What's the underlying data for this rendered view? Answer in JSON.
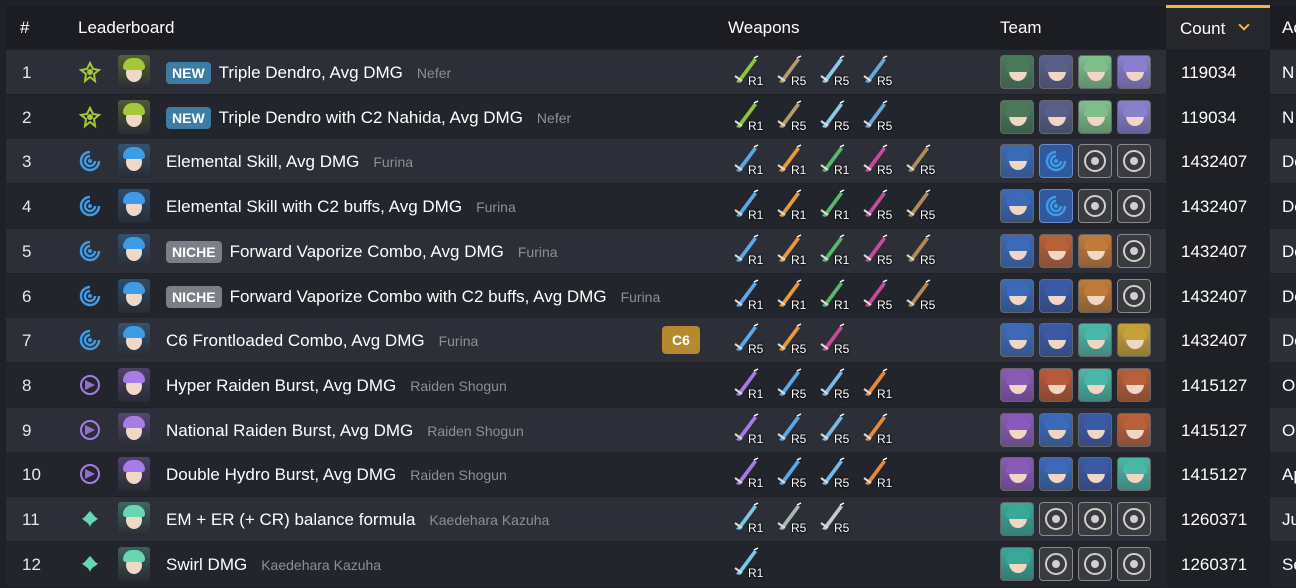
{
  "header": {
    "rank": "#",
    "leaderboard": "Leaderboard",
    "weapons": "Weapons",
    "team": "Team",
    "count": "Count",
    "extra": "Ac"
  },
  "colors": {
    "accent": "#f5b443",
    "dendro": "#a5c83b",
    "hydro": "#3e9be6",
    "electro": "#a77be8",
    "anemo": "#66d6b3",
    "new_badge": "#3d7da3",
    "niche_badge": "#7d7f86",
    "constellation_badge": "#b58a2e"
  },
  "rows": [
    {
      "rank": "1",
      "element": "dendro",
      "badge": "NEW",
      "badge_type": "new",
      "name": "Triple Dendro, Avg DMG",
      "owner": "Nefer",
      "constellation": "",
      "weapons": [
        {
          "icon": "catalyst-icon",
          "color": "#8fc43a",
          "ref": "R1"
        },
        {
          "icon": "catalyst-icon",
          "color": "#b59a6a",
          "ref": "R5"
        },
        {
          "icon": "catalyst-icon",
          "color": "#8ec9e8",
          "ref": "R5"
        },
        {
          "icon": "catalyst-icon",
          "color": "#6aa7d8",
          "ref": "R5"
        }
      ],
      "team": [
        "#4a7a5a",
        "#5a5f8a",
        "#7fbf8a",
        "#8a7fd0"
      ],
      "count": "119034",
      "extra": "N"
    },
    {
      "rank": "2",
      "element": "dendro",
      "badge": "NEW",
      "badge_type": "new",
      "name": "Triple Dendro with C2 Nahida, Avg DMG",
      "owner": "Nefer",
      "constellation": "",
      "weapons": [
        {
          "icon": "catalyst-icon",
          "color": "#8fc43a",
          "ref": "R1"
        },
        {
          "icon": "catalyst-icon",
          "color": "#b59a6a",
          "ref": "R5"
        },
        {
          "icon": "catalyst-icon",
          "color": "#8ec9e8",
          "ref": "R5"
        },
        {
          "icon": "catalyst-icon",
          "color": "#6aa7d8",
          "ref": "R5"
        }
      ],
      "team": [
        "#4a7a5a",
        "#5a5f8a",
        "#7fbf8a",
        "#8a7fd0"
      ],
      "count": "119034",
      "extra": "N"
    },
    {
      "rank": "3",
      "element": "hydro",
      "badge": "",
      "badge_type": "",
      "name": "Elemental Skill, Avg DMG",
      "owner": "Furina",
      "constellation": "",
      "weapons": [
        {
          "icon": "sword-icon",
          "color": "#5aa8e8",
          "ref": "R1"
        },
        {
          "icon": "sword-icon",
          "color": "#e89a3a",
          "ref": "R1"
        },
        {
          "icon": "sword-icon",
          "color": "#5ab86a",
          "ref": "R1"
        },
        {
          "icon": "sword-icon",
          "color": "#c84a9a",
          "ref": "R5"
        },
        {
          "icon": "sword-icon",
          "color": "#b08a5a",
          "ref": "R5"
        }
      ],
      "team": [
        "#3a6ab8",
        "hydro",
        "empty",
        "empty"
      ],
      "count": "1432407",
      "extra": "De"
    },
    {
      "rank": "4",
      "element": "hydro",
      "badge": "",
      "badge_type": "",
      "name": "Elemental Skill with C2 buffs, Avg DMG",
      "owner": "Furina",
      "constellation": "",
      "weapons": [
        {
          "icon": "sword-icon",
          "color": "#5aa8e8",
          "ref": "R1"
        },
        {
          "icon": "sword-icon",
          "color": "#e89a3a",
          "ref": "R1"
        },
        {
          "icon": "sword-icon",
          "color": "#5ab86a",
          "ref": "R1"
        },
        {
          "icon": "sword-icon",
          "color": "#c84a9a",
          "ref": "R5"
        },
        {
          "icon": "sword-icon",
          "color": "#b08a5a",
          "ref": "R5"
        }
      ],
      "team": [
        "#3a6ab8",
        "hydro",
        "empty",
        "empty"
      ],
      "count": "1432407",
      "extra": "De"
    },
    {
      "rank": "5",
      "element": "hydro",
      "badge": "NICHE",
      "badge_type": "niche",
      "name": "Forward Vaporize Combo, Avg DMG",
      "owner": "Furina",
      "constellation": "",
      "weapons": [
        {
          "icon": "sword-icon",
          "color": "#5aa8e8",
          "ref": "R1"
        },
        {
          "icon": "sword-icon",
          "color": "#e89a3a",
          "ref": "R1"
        },
        {
          "icon": "sword-icon",
          "color": "#5ab86a",
          "ref": "R1"
        },
        {
          "icon": "sword-icon",
          "color": "#c84a9a",
          "ref": "R5"
        },
        {
          "icon": "sword-icon",
          "color": "#b08a5a",
          "ref": "R5"
        }
      ],
      "team": [
        "#3a6ab8",
        "#b8603a",
        "#c07a3a",
        "empty"
      ],
      "count": "1432407",
      "extra": "De"
    },
    {
      "rank": "6",
      "element": "hydro",
      "badge": "NICHE",
      "badge_type": "niche",
      "name": "Forward Vaporize Combo with C2 buffs, Avg DMG",
      "owner": "Furina",
      "constellation": "",
      "weapons": [
        {
          "icon": "sword-icon",
          "color": "#5aa8e8",
          "ref": "R1"
        },
        {
          "icon": "sword-icon",
          "color": "#e89a3a",
          "ref": "R1"
        },
        {
          "icon": "sword-icon",
          "color": "#5ab86a",
          "ref": "R1"
        },
        {
          "icon": "sword-icon",
          "color": "#c84a9a",
          "ref": "R5"
        },
        {
          "icon": "sword-icon",
          "color": "#b08a5a",
          "ref": "R5"
        }
      ],
      "team": [
        "#3a6ab8",
        "#3a5aa8",
        "#c07a3a",
        "empty"
      ],
      "count": "1432407",
      "extra": "De"
    },
    {
      "rank": "7",
      "element": "hydro",
      "badge": "",
      "badge_type": "",
      "name": "C6 Frontloaded Combo, Avg DMG",
      "owner": "Furina",
      "constellation": "C6",
      "weapons": [
        {
          "icon": "sword-icon",
          "color": "#5aa8e8",
          "ref": "R5"
        },
        {
          "icon": "sword-icon",
          "color": "#e89a3a",
          "ref": "R5"
        },
        {
          "icon": "sword-icon",
          "color": "#c84a9a",
          "ref": "R5"
        }
      ],
      "team": [
        "#3a6ab8",
        "#3a5aa8",
        "#4ab8a8",
        "#c8a03a"
      ],
      "count": "1432407",
      "extra": "De"
    },
    {
      "rank": "8",
      "element": "electro",
      "badge": "",
      "badge_type": "",
      "name": "Hyper Raiden Burst, Avg DMG",
      "owner": "Raiden Shogun",
      "constellation": "",
      "weapons": [
        {
          "icon": "polearm-icon",
          "color": "#a87ae8",
          "ref": "R1"
        },
        {
          "icon": "polearm-icon",
          "color": "#5aa8e8",
          "ref": "R5"
        },
        {
          "icon": "polearm-icon",
          "color": "#7ab8e8",
          "ref": "R5"
        },
        {
          "icon": "polearm-icon",
          "color": "#e8883a",
          "ref": "R1"
        }
      ],
      "team": [
        "#8a5ab8",
        "#b85a3a",
        "#4ab8a8",
        "#b8603a"
      ],
      "count": "1415127",
      "extra": "O"
    },
    {
      "rank": "9",
      "element": "electro",
      "badge": "",
      "badge_type": "",
      "name": "National Raiden Burst, Avg DMG",
      "owner": "Raiden Shogun",
      "constellation": "",
      "weapons": [
        {
          "icon": "polearm-icon",
          "color": "#a87ae8",
          "ref": "R1"
        },
        {
          "icon": "polearm-icon",
          "color": "#5aa8e8",
          "ref": "R5"
        },
        {
          "icon": "polearm-icon",
          "color": "#7ab8e8",
          "ref": "R5"
        },
        {
          "icon": "polearm-icon",
          "color": "#e8883a",
          "ref": "R1"
        }
      ],
      "team": [
        "#8a5ab8",
        "#3a6ab8",
        "#3a5aa8",
        "#b8603a"
      ],
      "count": "1415127",
      "extra": "O"
    },
    {
      "rank": "10",
      "element": "electro",
      "badge": "",
      "badge_type": "",
      "name": "Double Hydro Burst, Avg DMG",
      "owner": "Raiden Shogun",
      "constellation": "",
      "weapons": [
        {
          "icon": "polearm-icon",
          "color": "#a87ae8",
          "ref": "R1"
        },
        {
          "icon": "polearm-icon",
          "color": "#5aa8e8",
          "ref": "R5"
        },
        {
          "icon": "polearm-icon",
          "color": "#7ab8e8",
          "ref": "R5"
        },
        {
          "icon": "polearm-icon",
          "color": "#e8883a",
          "ref": "R1"
        }
      ],
      "team": [
        "#8a5ab8",
        "#3a6ab8",
        "#3a5aa8",
        "#4ab8a8"
      ],
      "count": "1415127",
      "extra": "Ap"
    },
    {
      "rank": "11",
      "element": "anemo",
      "badge": "",
      "badge_type": "",
      "name": "EM + ER (+ CR) balance formula",
      "owner": "Kaedehara Kazuha",
      "constellation": "",
      "weapons": [
        {
          "icon": "sword-icon",
          "color": "#7ac8e8",
          "ref": "R1"
        },
        {
          "icon": "sword-icon",
          "color": "#a8b8b0",
          "ref": "R5"
        },
        {
          "icon": "sword-icon",
          "color": "#c8c8c8",
          "ref": "R5"
        }
      ],
      "team": [
        "#3aa898",
        "empty",
        "empty",
        "empty"
      ],
      "count": "1260371",
      "extra": "Ju"
    },
    {
      "rank": "12",
      "element": "anemo",
      "badge": "",
      "badge_type": "",
      "name": "Swirl DMG",
      "owner": "Kaedehara Kazuha",
      "constellation": "",
      "weapons": [
        {
          "icon": "sword-icon",
          "color": "#7ac8e8",
          "ref": "R1"
        }
      ],
      "team": [
        "#3aa898",
        "empty",
        "empty",
        "empty"
      ],
      "count": "1260371",
      "extra": "Se"
    }
  ]
}
